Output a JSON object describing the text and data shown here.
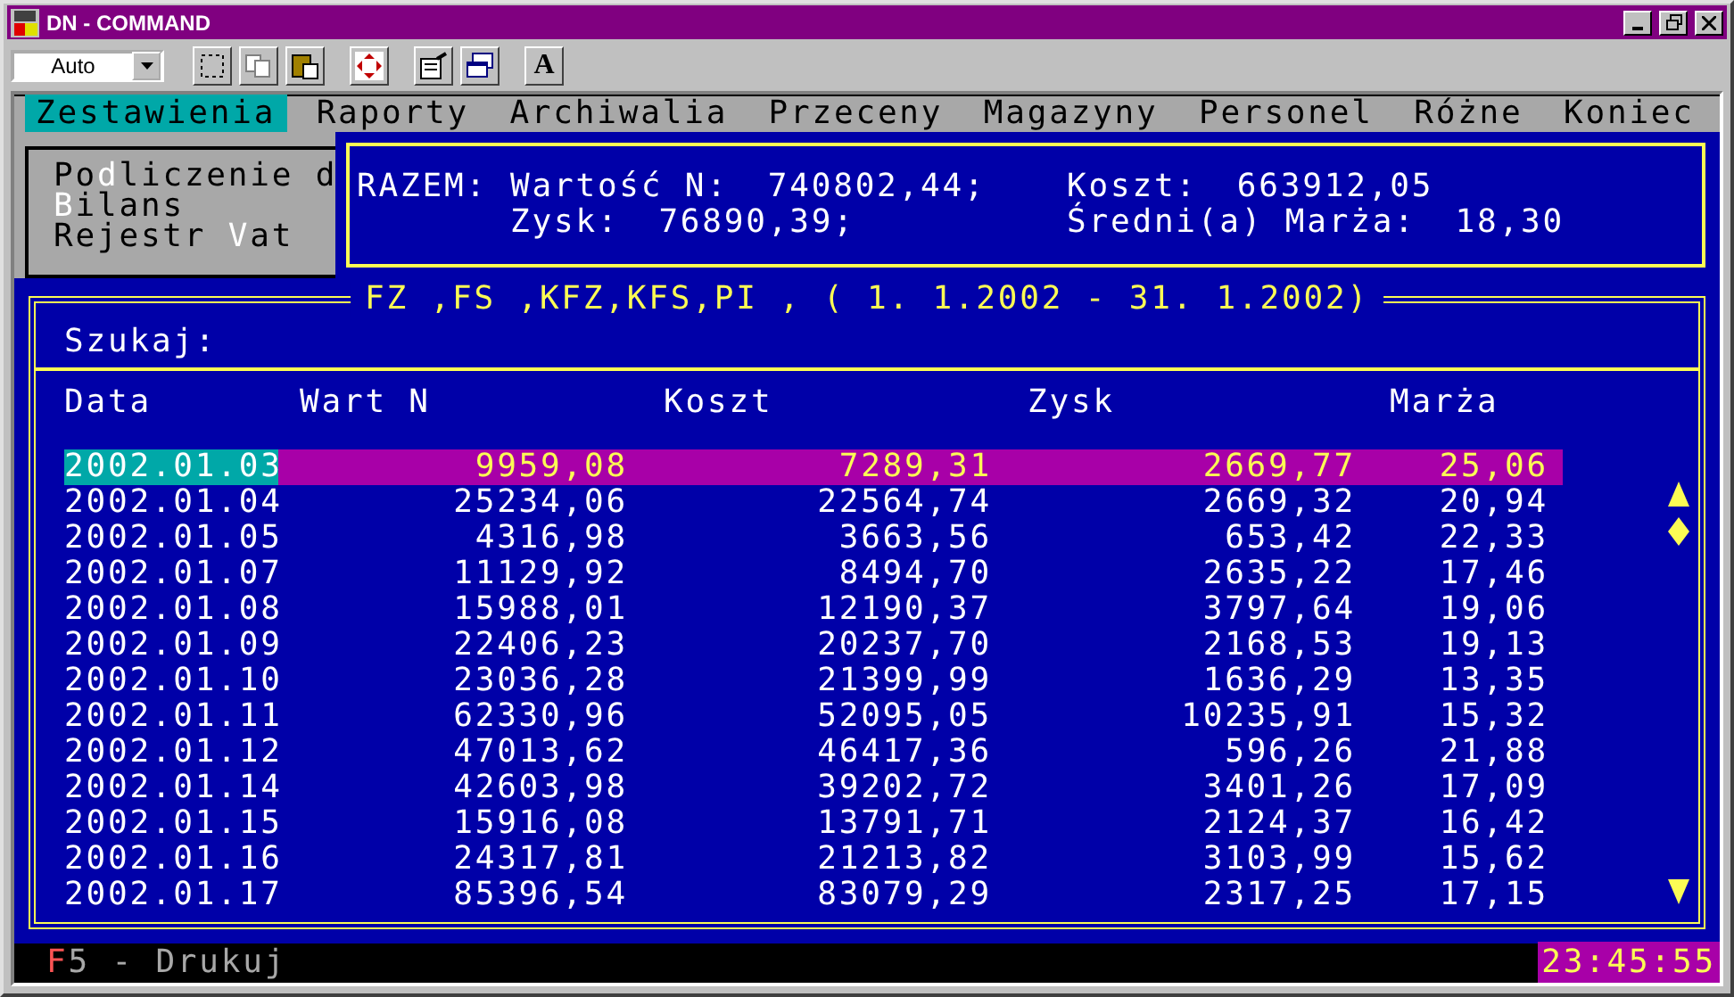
{
  "window": {
    "title": "DN - COMMAND"
  },
  "toolbar": {
    "font_select": {
      "value": "Auto"
    },
    "font_button": "A"
  },
  "menu": [
    {
      "label": "Zestawienia",
      "selected": true
    },
    {
      "label": "Raporty",
      "selected": false
    },
    {
      "label": "Archiwalia",
      "selected": false
    },
    {
      "label": "Przeceny",
      "selected": false
    },
    {
      "label": "Magazyny",
      "selected": false
    },
    {
      "label": "Personel",
      "selected": false
    },
    {
      "label": "Różne",
      "selected": false
    },
    {
      "label": "Koniec",
      "selected": false
    }
  ],
  "submenu": [
    {
      "before": "Po",
      "key": "d",
      "after": "liczenie d"
    },
    {
      "key": "B",
      "after": "ilans"
    },
    {
      "before": "Rejestr ",
      "key": "V",
      "after": "at"
    }
  ],
  "summary": {
    "label": "RAZEM:",
    "items": [
      {
        "label": "Wartość N:",
        "value": "740802,44;"
      },
      {
        "label": "Koszt:",
        "value": "663912,05"
      },
      {
        "label": "Zysk:",
        "value": "76890,39;"
      },
      {
        "label": "Średni(a) Marża:",
        "value": "18,30"
      }
    ]
  },
  "panel": {
    "title": "FZ ,FS ,KFZ,KFS,PI , ( 1. 1.2002 - 31. 1.2002)",
    "search_label": "Szukaj:"
  },
  "table": {
    "columns": [
      "Data",
      "Wart N",
      "Koszt",
      "Zysk",
      "Marża"
    ],
    "rows": [
      {
        "cells": [
          "2002.01.03",
          "9959,08",
          "7289,31",
          "2669,77",
          "25,06"
        ],
        "selected": true
      },
      {
        "cells": [
          "2002.01.04",
          "25234,06",
          "22564,74",
          "2669,32",
          "20,94"
        ],
        "selected": false
      },
      {
        "cells": [
          "2002.01.05",
          "4316,98",
          "3663,56",
          "653,42",
          "22,33"
        ],
        "selected": false
      },
      {
        "cells": [
          "2002.01.07",
          "11129,92",
          "8494,70",
          "2635,22",
          "17,46"
        ],
        "selected": false
      },
      {
        "cells": [
          "2002.01.08",
          "15988,01",
          "12190,37",
          "3797,64",
          "19,06"
        ],
        "selected": false
      },
      {
        "cells": [
          "2002.01.09",
          "22406,23",
          "20237,70",
          "2168,53",
          "19,13"
        ],
        "selected": false
      },
      {
        "cells": [
          "2002.01.10",
          "23036,28",
          "21399,99",
          "1636,29",
          "13,35"
        ],
        "selected": false
      },
      {
        "cells": [
          "2002.01.11",
          "62330,96",
          "52095,05",
          "10235,91",
          "15,32"
        ],
        "selected": false
      },
      {
        "cells": [
          "2002.01.12",
          "47013,62",
          "46417,36",
          "596,26",
          "21,88"
        ],
        "selected": false
      },
      {
        "cells": [
          "2002.01.14",
          "42603,98",
          "39202,72",
          "3401,26",
          "17,09"
        ],
        "selected": false
      },
      {
        "cells": [
          "2002.01.15",
          "15916,08",
          "13791,71",
          "2124,37",
          "16,42"
        ],
        "selected": false
      },
      {
        "cells": [
          "2002.01.16",
          "24317,81",
          "21213,82",
          "3103,99",
          "15,62"
        ],
        "selected": false
      },
      {
        "cells": [
          "2002.01.17",
          "85396,54",
          "83079,29",
          "2317,25",
          "17,15"
        ],
        "selected": false
      }
    ]
  },
  "status_bar": {
    "key": "F",
    "text": "5 - Drukuj",
    "clock": "23:45:55"
  }
}
